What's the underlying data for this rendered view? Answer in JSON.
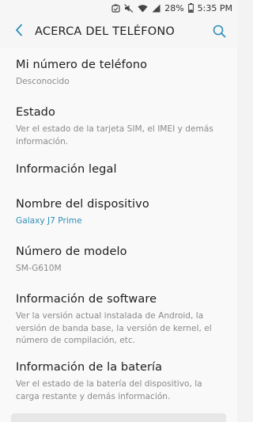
{
  "status_bar": {
    "battery_percent": "28%",
    "time": "5:35 PM",
    "icons": [
      "notification-icon",
      "mute-icon",
      "wifi-icon",
      "signal-icon",
      "battery-icon"
    ]
  },
  "app_bar": {
    "title": "ACERCA DEL TELÉFONO",
    "accent_color": "#2d8fb8",
    "icons": [
      "back-arrow-icon",
      "search-icon"
    ]
  },
  "items": [
    {
      "title": "Mi número de teléfono",
      "subtitle": "Desconocido"
    },
    {
      "title": "Estado",
      "subtitle": "Ver el estado de la tarjeta SIM, el IMEI y demás información."
    },
    {
      "title": "Información legal",
      "subtitle": ""
    },
    {
      "title": "Nombre del dispositivo",
      "subtitle": "Galaxy J7 Prime"
    },
    {
      "title": "Número de modelo",
      "subtitle": "SM-G610M"
    },
    {
      "title": "Información de software",
      "subtitle": "Ver la versión actual instalada de Android, la versión de banda base, la versión de kernel, el número de compilación, etc."
    },
    {
      "title": "Información de la batería",
      "subtitle": "Ver el estado de la batería del dispositivo, la carga restante y demás información."
    }
  ]
}
